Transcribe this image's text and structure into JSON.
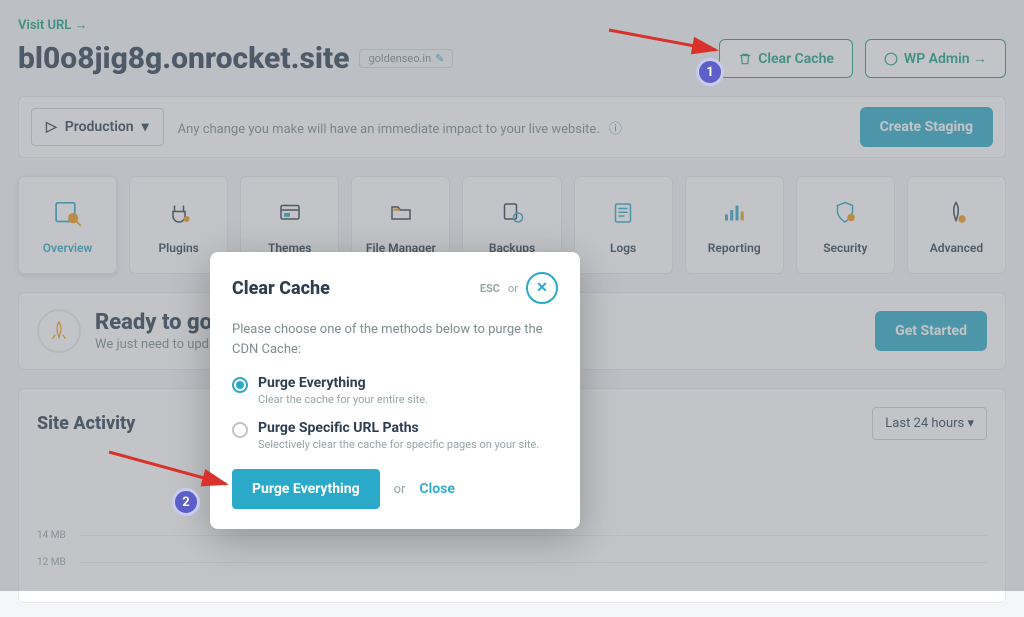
{
  "header": {
    "visit_url": "Visit URL →",
    "site_title": "bl0o8jig8g.onrocket.site",
    "site_chip": "goldenseo.in",
    "clear_cache": "Clear Cache",
    "wp_admin": "WP Admin →"
  },
  "banner": {
    "production": "Production",
    "text": "Any change you make will have an immediate impact to your live website.",
    "create_staging": "Create Staging"
  },
  "nav": [
    {
      "label": "Overview"
    },
    {
      "label": "Plugins"
    },
    {
      "label": "Themes"
    },
    {
      "label": "File Manager"
    },
    {
      "label": "Backups"
    },
    {
      "label": "Logs"
    },
    {
      "label": "Reporting"
    },
    {
      "label": "Security"
    },
    {
      "label": "Advanced"
    }
  ],
  "ready": {
    "title": "Ready to go li",
    "sub": "We just need to updat",
    "get_started": "Get Started"
  },
  "activity": {
    "title": "Site Activity",
    "time": "Last 24 hours",
    "y_labels": [
      "14 MB",
      "12 MB"
    ]
  },
  "modal": {
    "title": "Clear Cache",
    "esc": "ESC",
    "or": "or",
    "description": "Please choose one of the methods below to purge the CDN Cache:",
    "option1_label": "Purge Everything",
    "option1_desc": "Clear the cache for your entire site.",
    "option2_label": "Purge Specific URL Paths",
    "option2_desc": "Selectively clear the cache for specific pages on your site.",
    "purge_btn": "Purge Everything",
    "action_or": "or",
    "close": "Close"
  },
  "annotations": {
    "badge1": "1",
    "badge2": "2"
  }
}
